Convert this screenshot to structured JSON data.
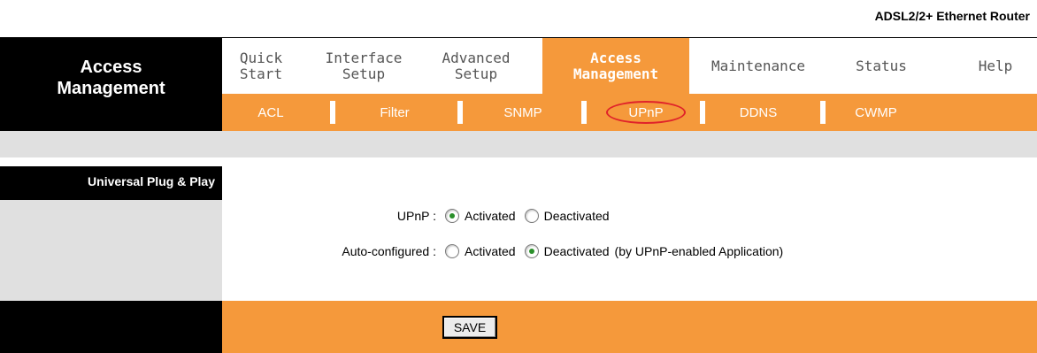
{
  "header": {
    "model": "ADSL2/2+ Ethernet Router",
    "section_title_line1": "Access",
    "section_title_line2": "Management"
  },
  "main_nav": [
    {
      "line1": "Quick",
      "line2": "Start",
      "active": false
    },
    {
      "line1": "Interface",
      "line2": "Setup",
      "active": false
    },
    {
      "line1": "Advanced",
      "line2": "Setup",
      "active": false
    },
    {
      "line1": "Access",
      "line2": "Management",
      "active": true
    },
    {
      "line1": "Maintenance",
      "line2": "",
      "active": false
    },
    {
      "line1": "Status",
      "line2": "",
      "active": false
    },
    {
      "line1": "Help",
      "line2": "",
      "active": false
    }
  ],
  "sub_nav": [
    {
      "label": "ACL"
    },
    {
      "label": "Filter"
    },
    {
      "label": "SNMP"
    },
    {
      "label": "UPnP",
      "selected": true
    },
    {
      "label": "DDNS"
    },
    {
      "label": "CWMP"
    }
  ],
  "section": {
    "title": "Universal Plug & Play"
  },
  "form": {
    "upnp": {
      "label": "UPnP :",
      "options": [
        "Activated",
        "Deactivated"
      ],
      "selected": "Activated"
    },
    "auto_configured": {
      "label": "Auto-configured :",
      "options": [
        "Activated",
        "Deactivated"
      ],
      "selected": "Deactivated",
      "note": "(by UPnP-enabled Application)"
    }
  },
  "footer": {
    "save_label": "SAVE"
  },
  "colors": {
    "accent": "#f5993b",
    "band": "#e0e0e0",
    "dark": "#000000"
  }
}
